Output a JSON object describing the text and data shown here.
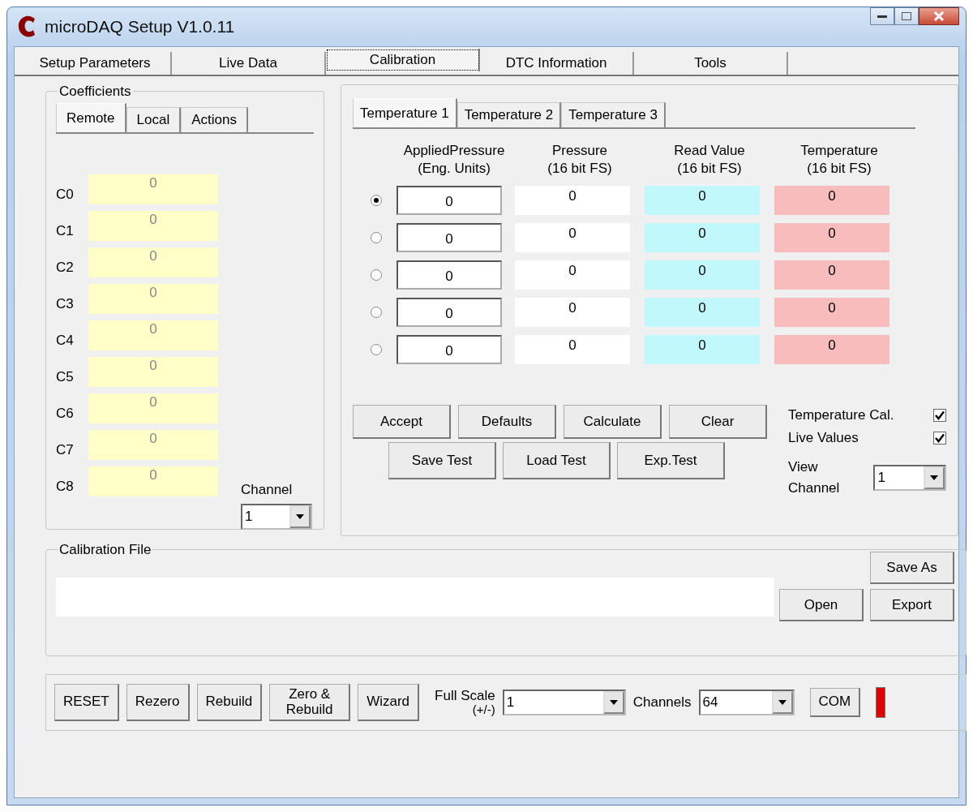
{
  "window": {
    "title": "microDAQ Setup   V1.0.11"
  },
  "tabs": [
    {
      "label": "Setup Parameters",
      "selected": false
    },
    {
      "label": "Live Data",
      "selected": false
    },
    {
      "label": "Calibration",
      "selected": true
    },
    {
      "label": "DTC Information",
      "selected": false
    },
    {
      "label": "Tools",
      "selected": false
    }
  ],
  "coefficients": {
    "title": "Coefficients",
    "tabs": [
      {
        "label": "Remote",
        "selected": true
      },
      {
        "label": "Local",
        "selected": false
      },
      {
        "label": "Actions",
        "selected": false
      }
    ],
    "rows": [
      {
        "label": "C0",
        "value": "0"
      },
      {
        "label": "C1",
        "value": "0"
      },
      {
        "label": "C2",
        "value": "0"
      },
      {
        "label": "C3",
        "value": "0"
      },
      {
        "label": "C4",
        "value": "0"
      },
      {
        "label": "C5",
        "value": "0"
      },
      {
        "label": "C6",
        "value": "0"
      },
      {
        "label": "C7",
        "value": "0"
      },
      {
        "label": "C8",
        "value": "0"
      }
    ],
    "channel": {
      "label": "Channel",
      "value": "1"
    }
  },
  "calibration": {
    "tabs": [
      {
        "label": "Temperature 1",
        "selected": true
      },
      {
        "label": "Temperature 2",
        "selected": false
      },
      {
        "label": "Temperature 3",
        "selected": false
      }
    ],
    "columns": [
      {
        "title": "AppliedPressure",
        "unit": "(Eng. Units)"
      },
      {
        "title": "Pressure",
        "unit": "(16 bit FS)"
      },
      {
        "title": "Read Value",
        "unit": "(16 bit FS)"
      },
      {
        "title": "Temperature",
        "unit": "(16 bit FS)"
      }
    ],
    "rows": [
      {
        "selected": true,
        "applied": "0",
        "pressure": "0",
        "read_value": "0",
        "temperature": "0"
      },
      {
        "selected": false,
        "applied": "0",
        "pressure": "0",
        "read_value": "0",
        "temperature": "0"
      },
      {
        "selected": false,
        "applied": "0",
        "pressure": "0",
        "read_value": "0",
        "temperature": "0"
      },
      {
        "selected": false,
        "applied": "0",
        "pressure": "0",
        "read_value": "0",
        "temperature": "0"
      },
      {
        "selected": false,
        "applied": "0",
        "pressure": "0",
        "read_value": "0",
        "temperature": "0"
      }
    ],
    "buttons_top": [
      "Accept",
      "Defaults",
      "Calculate",
      "Clear"
    ],
    "buttons_bottom": [
      "Save Test",
      "Load Test",
      "Exp.Test"
    ],
    "options": [
      {
        "label": "Temperature Cal.",
        "checked": true
      },
      {
        "label": "Live Values",
        "checked": true
      }
    ],
    "view_channel": {
      "label": "View Channel",
      "value": "1"
    }
  },
  "calibration_file": {
    "title": "Calibration File",
    "save_as": "Save As",
    "open": "Open",
    "export": "Export"
  },
  "toolbar": {
    "buttons": [
      "RESET",
      "Rezero",
      "Rebuild",
      "Zero & Rebuild",
      "Wizard"
    ],
    "full_scale": {
      "label": "Full Scale",
      "sublabel": "(+/-)",
      "value": "1"
    },
    "channels": {
      "label": "Channels",
      "value": "64"
    },
    "com": "COM",
    "connected": false
  }
}
